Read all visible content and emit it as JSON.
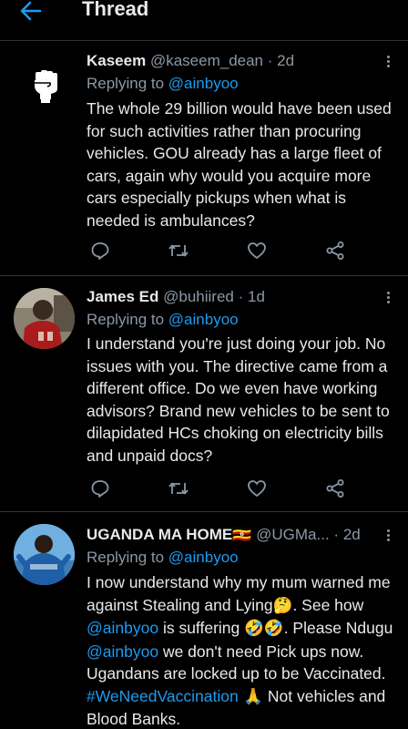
{
  "header": {
    "title": "Thread"
  },
  "tweets": [
    {
      "author": "Kaseem",
      "handle": "@kaseem_dean",
      "time": "2d",
      "replying_prefix": "Replying to",
      "replying_handle": "@ainbyoo",
      "body": "The whole 29 billion would have been used for such activities rather than procuring vehicles. GOU already has a large fleet of cars, again why would you acquire more cars especially pickups when what is needed is ambulances?"
    },
    {
      "author": "James Ed",
      "handle": "@buhiired",
      "time": "1d",
      "replying_prefix": "Replying to",
      "replying_handle": "@ainbyoo",
      "body": "I understand you're just doing your job. No issues with you. The directive came from a different office. Do we even have working advisors? Brand new vehicles to be sent to dilapidated HCs choking on electricity bills and unpaid docs?"
    },
    {
      "author": "UGANDA MA HOME",
      "author_flag": "🇺🇬",
      "handle": "@UGMa...",
      "time": "2d",
      "replying_prefix": "Replying to",
      "replying_handle": "@ainbyoo",
      "body": {
        "p1": "I now understand why my mum warned me against Stealing and Lying",
        "e1": "🤔",
        "p2": ". See how ",
        "m1": "@ainbyoo",
        "p3": " is suffering ",
        "e2": "🤣🤣",
        "p4": ". Please Ndugu ",
        "m2": "@ainbyoo",
        "p5": " we don't need Pick ups now. Ugandans are locked up to be Vaccinated. ",
        "h1": "#WeNeedVaccination",
        "e3": " 🙏",
        "p6": " Not vehicles and Blood Banks."
      }
    }
  ],
  "icons": {
    "back": "arrow-left-icon",
    "reply": "reply-icon",
    "retweet": "retweet-icon",
    "like": "heart-icon",
    "share": "share-icon",
    "more": "more-vertical-icon"
  },
  "colors": {
    "background": "#000000",
    "accent": "#1d9bf0",
    "text": "#e7e9ea",
    "secondary": "#8b98a5",
    "divider": "#2f3336"
  }
}
